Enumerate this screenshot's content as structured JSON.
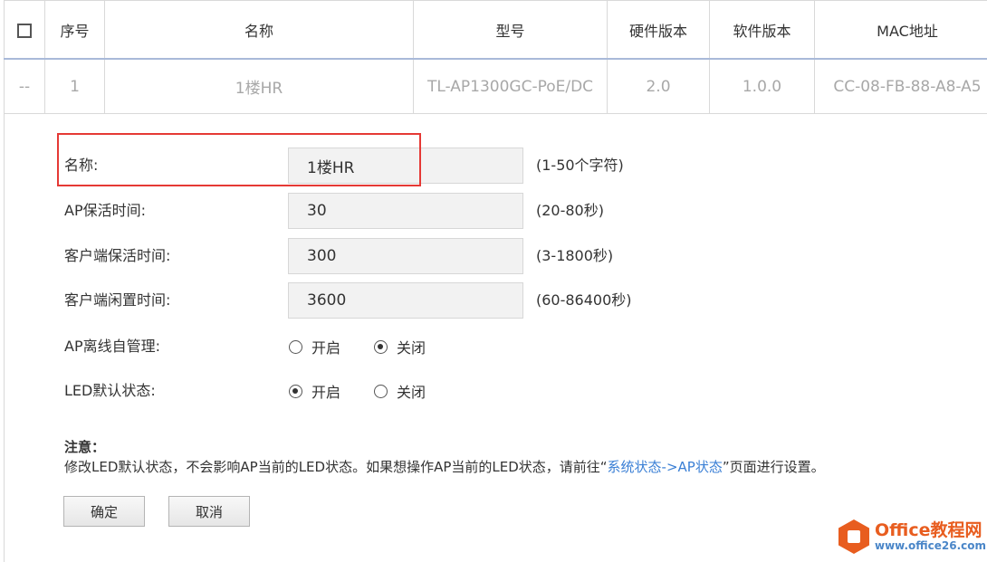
{
  "table": {
    "headers": [
      "",
      "序号",
      "名称",
      "型号",
      "硬件版本",
      "软件版本",
      "MAC地址"
    ],
    "rows": [
      [
        "--",
        "1",
        "1楼HR",
        "TL-AP1300GC-PoE/DC",
        "2.0",
        "1.0.0",
        "CC-08-FB-88-A8-A5"
      ]
    ]
  },
  "form": {
    "name": {
      "label": "名称:",
      "value": "1楼HR",
      "hint": "(1-50个字符)"
    },
    "ap_keepalive": {
      "label": "AP保活时间:",
      "value": "30",
      "hint": "(20-80秒)"
    },
    "client_keepalive": {
      "label": "客户端保活时间:",
      "value": "300",
      "hint": "(3-1800秒)"
    },
    "client_idle": {
      "label": "客户端闲置时间:",
      "value": "3600",
      "hint": "(60-86400秒)"
    },
    "ap_offline": {
      "label": "AP离线自管理:",
      "opt_on": "开启",
      "opt_off": "关闭",
      "selected": "off"
    },
    "led_default": {
      "label": "LED默认状态:",
      "opt_on": "开启",
      "opt_off": "关闭",
      "selected": "on"
    }
  },
  "note": {
    "title": "注意：",
    "body_before": "修改LED默认状态，不会影响AP当前的LED状态。如果想操作AP当前的LED状态，请前往“",
    "link": "系统状态->AP状态",
    "body_after": "”页面进行设置。"
  },
  "buttons": {
    "ok": "确定",
    "cancel": "取消"
  },
  "watermark": {
    "brand": "Office教程网",
    "url": "www.office26.com"
  },
  "colors": {
    "highlight": "#e53935",
    "link": "#3a7fd5",
    "watermark": "#e85d1f"
  }
}
